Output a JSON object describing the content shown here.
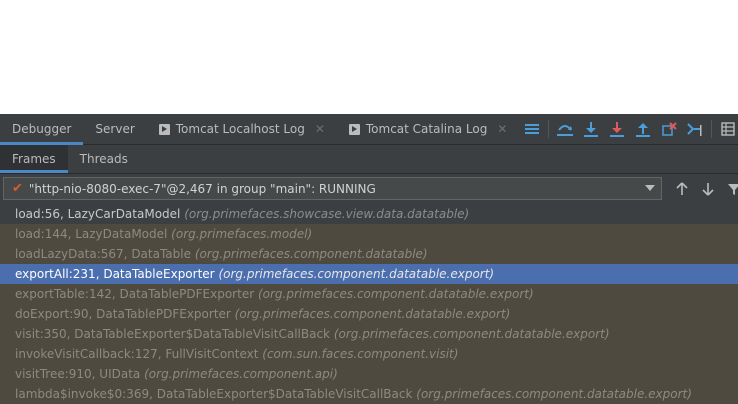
{
  "toolbar": {
    "tabs": [
      {
        "label": "Debugger"
      },
      {
        "label": "Server"
      },
      {
        "label": "Tomcat Localhost Log"
      },
      {
        "label": "Tomcat Catalina Log"
      }
    ],
    "icons": [
      "menu-icon",
      "show-execution-point-icon",
      "step-over-icon",
      "step-into-icon",
      "force-step-into-icon",
      "step-out-icon",
      "drop-frame-icon",
      "run-to-cursor-icon",
      "evaluate-expression-icon",
      "trace-icon"
    ]
  },
  "subtabs": [
    {
      "label": "Frames"
    },
    {
      "label": "Threads"
    }
  ],
  "thread": {
    "label": "\"http-nio-8080-exec-7\"@2,467 in group \"main\": RUNNING"
  },
  "frames": [
    {
      "method": "load:56, LazyCarDataModel",
      "package": "(org.primefaces.showcase.view.data.datatable)",
      "state": "current"
    },
    {
      "method": "load:144, LazyDataModel",
      "package": "(org.primefaces.model)",
      "state": "library"
    },
    {
      "method": "loadLazyData:567, DataTable",
      "package": "(org.primefaces.component.datatable)",
      "state": "library"
    },
    {
      "method": "exportAll:231, DataTableExporter",
      "package": "(org.primefaces.component.datatable.export)",
      "state": "selected"
    },
    {
      "method": "exportTable:142, DataTablePDFExporter",
      "package": "(org.primefaces.component.datatable.export)",
      "state": "library"
    },
    {
      "method": "doExport:90, DataTablePDFExporter",
      "package": "(org.primefaces.component.datatable.export)",
      "state": "library"
    },
    {
      "method": "visit:350, DataTableExporter$DataTableVisitCallBack",
      "package": "(org.primefaces.component.datatable.export)",
      "state": "library"
    },
    {
      "method": "invokeVisitCallback:127, FullVisitContext",
      "package": "(com.sun.faces.component.visit)",
      "state": "library"
    },
    {
      "method": "visitTree:910, UIData",
      "package": "(org.primefaces.component.api)",
      "state": "library"
    },
    {
      "method": "lambda$invoke$0:369, DataTableExporter$DataTableVisitCallBack",
      "package": "(org.primefaces.component.datatable.export)",
      "state": "library"
    }
  ],
  "colors": {
    "panel": "#3c3f41",
    "library_frame_bg": "#4e4a3f",
    "selection": "#4b6eaf",
    "accent": "#4a88c7",
    "step_red": "#e05a5a",
    "step_blue": "#4a9eda"
  }
}
